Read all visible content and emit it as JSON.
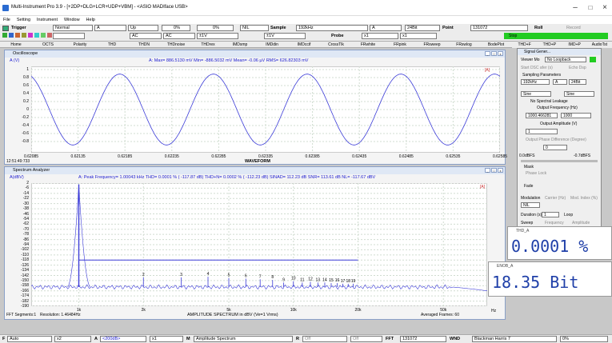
{
  "window": {
    "title": "Multi-Instrument Pro 3.9  -  [+2DP+DLG+LCR+UDP+VBM]  -  <ASIO MADIface USB>"
  },
  "menu": [
    "File",
    "Setting",
    "Instrument",
    "Window",
    "Help"
  ],
  "toolbar": {
    "trigger_label": "Trigger",
    "trigger_mode": "Normal",
    "channel": "A",
    "edge": "Up",
    "pct1": "0%",
    "pct2": "0%",
    "nil": "NIL",
    "sample_label": "Sample",
    "sample_rate": "192kHz",
    "ch2": "A",
    "bits": "24Bit",
    "point_label": "Point",
    "points": "131072",
    "roll_label": "Roll",
    "record_label": "Record",
    "stop_label": "Stop",
    "ac1": "AC",
    "ac2": "AC",
    "v1": "±1V",
    "v2": "±1V",
    "probe_label": "Probe",
    "probe1": "x1",
    "probe2": "x1"
  },
  "tabs": [
    "Home",
    "OCTS",
    "Polarity",
    "THD",
    "THDN",
    "THDnoise",
    "THDrex",
    "IMDsmp",
    "IMDdin",
    "IMDccif",
    "CrossTlk",
    "FRwhite",
    "FRpink",
    "FRsweep",
    "FRswlog",
    "BodePlot",
    "THD+F",
    "THD+P",
    "IMD+P",
    "AudioTst"
  ],
  "oscilloscope": {
    "title": "Oscilloscope",
    "axis": "A (V)",
    "stats": "A: Max=    886.5130 mV  Min=    -886.5032 mV  Mean=      -0.06  µV  RMS=     626.82303 mV",
    "yticks": [
      "1",
      "0.8",
      "0.6",
      "0.4",
      "0.2",
      "0",
      "-0.2",
      "-0.4",
      "-0.6",
      "-0.8"
    ],
    "xticks": [
      "0.62085",
      "0.62135",
      "0.62185",
      "0.62235",
      "0.62285",
      "0.62335",
      "0.62385",
      "0.62435",
      "0.62485",
      "0.62535",
      "0.62585"
    ],
    "xlabel": "WAVEFORM",
    "time": "12:51:49:733",
    "marker": "[A]"
  },
  "spectrum": {
    "title": "Spectrum Analyzer",
    "axis": "A(dBV)",
    "stats": "A: Peak Frequency=   1.00043  kHz  THD=     0.0001 % ( -117.87 dB)  THD+N=     0.0002 % ( -112.23 dB)  SINAD=   112.23 dB  SNR=   113.61 dB  NL=   -117.67 dBV",
    "yticks": [
      "2",
      "-6",
      "-14",
      "-22",
      "-30",
      "-38",
      "-46",
      "-54",
      "-62",
      "-70",
      "-78",
      "-86",
      "-94",
      "-102",
      "-110",
      "-118",
      "-126",
      "-134",
      "-142",
      "-150",
      "-158",
      "-166",
      "-174",
      "-182",
      "-190"
    ],
    "xticks": [
      "1k",
      "2k",
      "5k",
      "10k",
      "20k",
      "50k"
    ],
    "x_unit": "Hz",
    "xlabel": "AMPLITUDE SPECTRUM in dBV (Ve=1 Vrms)",
    "fft_segments": "FFT Segments:1",
    "resolution": "Resolution: 1.46484Hz",
    "averaged": "Averaged Frames: 60",
    "harmonics": [
      "1",
      "2",
      "3",
      "4",
      "5",
      "6",
      "7",
      "8",
      "9",
      "10",
      "11",
      "12",
      "13",
      "14",
      "15",
      "16",
      "17",
      "18",
      "19"
    ],
    "marker": "[A]"
  },
  "chart_data": [
    {
      "type": "line",
      "title": "",
      "xlabel": "WAVEFORM",
      "ylabel": "A (V)",
      "ylim": [
        -1,
        1
      ],
      "xlim": [
        0.62085,
        0.62585
      ],
      "series": [
        {
          "name": "A",
          "frequency_khz": 1.00043,
          "amplitude_v": 0.8865
        }
      ]
    },
    {
      "type": "line",
      "title": "",
      "xlabel": "AMPLITUDE SPECTRUM in dBV (Ve=1 Vrms)",
      "ylabel": "A(dBV)",
      "ylim": [
        -190,
        2
      ],
      "xlim": [
        600,
        80000
      ],
      "xscale": "log",
      "series": [
        {
          "name": "A",
          "peaks": [
            {
              "x": 1000,
              "y": 0
            },
            {
              "x": 2000,
              "y": -145
            },
            {
              "x": 3000,
              "y": -145
            },
            {
              "x": 4000,
              "y": -144
            },
            {
              "x": 5000,
              "y": -146
            },
            {
              "x": 6000,
              "y": -147
            },
            {
              "x": 7000,
              "y": -148
            },
            {
              "x": 8000,
              "y": -149
            },
            {
              "x": 9000,
              "y": -153
            },
            {
              "x": 10000,
              "y": -151
            },
            {
              "x": 11000,
              "y": -153
            },
            {
              "x": 12000,
              "y": -152
            },
            {
              "x": 13000,
              "y": -153
            },
            {
              "x": 14000,
              "y": -153
            },
            {
              "x": 15000,
              "y": -154
            },
            {
              "x": 16000,
              "y": -154
            },
            {
              "x": 17000,
              "y": -155
            },
            {
              "x": 18000,
              "y": -155
            },
            {
              "x": 19000,
              "y": -155
            }
          ],
          "noise_floor": -160,
          "threshold": -118
        }
      ]
    }
  ],
  "siggen": {
    "title": "Signal Gener...",
    "viewer": "Viewer Mo",
    "loopback": "No Loopback",
    "start": "Start DSC afer (s)",
    "echo": "Echo Dsp",
    "sampling": "Sampling Parameters",
    "srate": "192kHz",
    "ch": "A",
    "bits": "24Bit",
    "wave": "Sine",
    "wave2": "Sine",
    "leakage": "No Spectral Leakage",
    "outfreq": "Output Frequency (Hz)",
    "freq": "1000.466281",
    "freq2": "1000",
    "outamp": "Output Amplitude (V)",
    "amp": "1",
    "phase": "Output Phase Difference (Degree)",
    "phval": "0",
    "dbfs_l": "0.0dBFS",
    "dbfs_r": "-0.7dBFS",
    "mask": "Mask",
    "phaselock": "Phase Lock",
    "fade": "Fade",
    "modulation": "Modulation",
    "carrier": "Carrier (Hz)",
    "mod": "Mod. Index (%)",
    "nil": "NIL",
    "duration": "Duration (s)",
    "dval": "1",
    "loop": "Loop",
    "sweep": "Sweep",
    "frequency": "Frequency",
    "amplitude": "Amplitude"
  },
  "thd_meter": {
    "title": "THD_A",
    "value": "0.0001 %"
  },
  "enob_meter": {
    "title": "ENOB_A",
    "value": "18.35 Bit"
  },
  "bottombar": {
    "f": "F",
    "auto": "Auto",
    "x2": "x2",
    "a": "A",
    "sel": "<200dB>",
    "x1": "x1",
    "m": "M",
    "mode": "Amplitude Spectrum",
    "r": "R",
    "off1": "Off",
    "off2": "Off",
    "fft": "FFT",
    "fftsize": "131072",
    "wnd": "WND",
    "window": "Blackman Harris 7",
    "pct": "0%"
  }
}
